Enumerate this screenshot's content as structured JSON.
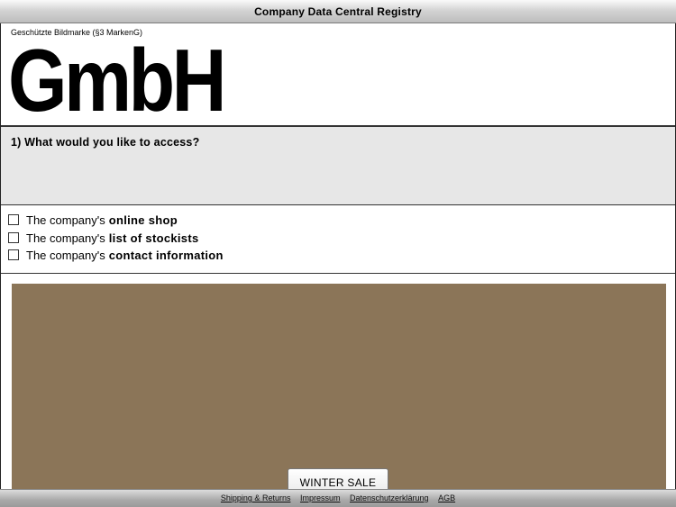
{
  "window": {
    "title": "Company Data Central Registry"
  },
  "header": {
    "trademark_note": "Geschützte Bildmarke (§3 MarkenG)",
    "logo_text": "GmbH"
  },
  "question": {
    "text": "1) What would you like to access?"
  },
  "options": [
    {
      "prefix": "The company's",
      "emphasis": "online shop",
      "checked": false
    },
    {
      "prefix": "The company's",
      "emphasis": "list of stockists",
      "checked": false
    },
    {
      "prefix": "The company's",
      "emphasis": "contact information",
      "checked": false
    }
  ],
  "banner": {
    "color": "#8b7558",
    "button_label": "WINTER SALE"
  },
  "footer": {
    "links": [
      "Shipping & Returns",
      "Impressum",
      "Datenschutzerklärung",
      "AGB"
    ]
  }
}
